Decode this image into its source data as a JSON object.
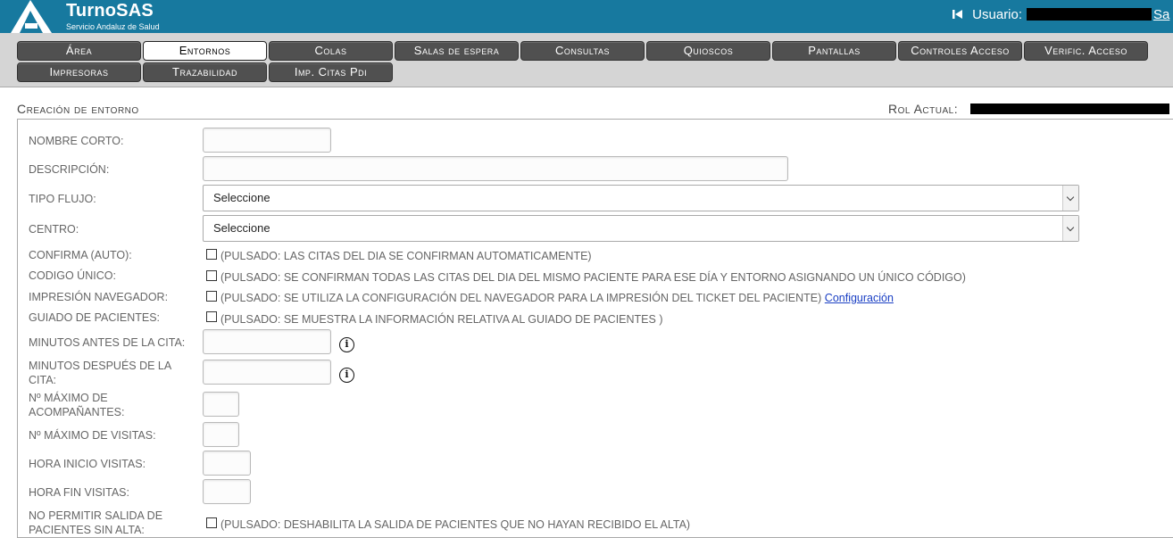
{
  "header": {
    "brand_name": "TurnoSAS",
    "brand_subtitle": "Servicio Andaluz de Salud",
    "user_label": "Usuario:",
    "logout_label": "Sa",
    "brand_color": "#17799f"
  },
  "menu": {
    "tabs_row1": [
      "Área",
      "Entornos",
      "Colas",
      "Salas de espera",
      "Consultas",
      "Quioscos",
      "Pantallas",
      "Controles Acceso",
      "Verific. Acceso"
    ],
    "tabs_row2": [
      "Impresoras",
      "Trazabilidad",
      "Imp. Citas Pdi"
    ],
    "active_tab": "Entornos"
  },
  "section": {
    "title": "Creación de entorno",
    "role_label": "Rol Actual:"
  },
  "form": {
    "nombre_corto": {
      "label": "NOMBRE CORTO:",
      "value": ""
    },
    "descripcion": {
      "label": "DESCRIPCIÓN:",
      "value": ""
    },
    "tipo_flujo": {
      "label": "TIPO FLUJO:",
      "selected": "Seleccione"
    },
    "centro": {
      "label": "CENTRO:",
      "selected": "Seleccione"
    },
    "confirma_auto": {
      "label": "CONFIRMA (AUTO):",
      "desc": "(PULSADO: LAS CITAS DEL DIA SE CONFIRMAN AUTOMATICAMENTE)",
      "checked": false
    },
    "codigo_unico": {
      "label": "CODIGO ÚNICO:",
      "desc": "(PULSADO: SE CONFIRMAN TODAS LAS CITAS DEL DIA DEL MISMO PACIENTE PARA ESE DÍA Y ENTORNO ASIGNANDO UN ÚNICO CÓDIGO)",
      "checked": false
    },
    "impresion_navegador": {
      "label": "IMPRESIÓN NAVEGADOR:",
      "desc": "(PULSADO: SE UTILIZA LA CONFIGURACIÓN DEL NAVEGADOR PARA LA IMPRESIÓN DEL TICKET DEL PACIENTE)",
      "link": "Configuración",
      "checked": false
    },
    "guiado_pacientes": {
      "label": "GUIADO DE PACIENTES:",
      "desc": "(PULSADO: SE MUESTRA LA INFORMACIÓN RELATIVA AL GUIADO DE PACIENTES )",
      "checked": false
    },
    "minutos_antes": {
      "label": "MINUTOS ANTES DE LA CITA:",
      "value": ""
    },
    "minutos_despues": {
      "label_line1": "MINUTOS DESPUÉS DE LA",
      "label_line2": "CITA:",
      "value": ""
    },
    "max_acompanantes": {
      "label_line1": "Nº MÁXIMO DE",
      "label_line2": "ACOMPAÑANTES:",
      "value": ""
    },
    "max_visitas": {
      "label": "Nº MÁXIMO DE VISITAS:",
      "value": ""
    },
    "hora_inicio": {
      "label": "HORA INICIO VISITAS:",
      "value": ""
    },
    "hora_fin": {
      "label": "HORA FIN VISITAS:",
      "value": ""
    },
    "no_permitir_salida": {
      "label_line1": "NO PERMITIR SALIDA DE",
      "label_line2": "PACIENTES SIN ALTA:",
      "desc": "(PULSADO: DESHABILITA LA SALIDA DE PACIENTES QUE NO HAYAN RECIBIDO EL ALTA)",
      "checked": false
    }
  }
}
